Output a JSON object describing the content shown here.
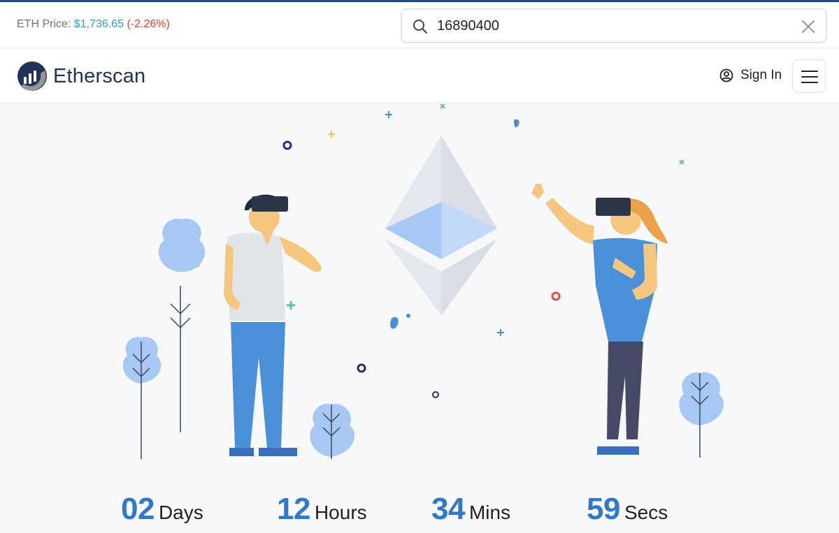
{
  "topbar": {
    "eth_price_label": "ETH Price:",
    "eth_price_value": "$1,736.65",
    "eth_price_change": "(-2.26%)"
  },
  "search": {
    "value": "16890400",
    "icon": "search-icon",
    "clear_icon": "close-icon"
  },
  "navbar": {
    "brand": "Etherscan",
    "sign_in_label": "Sign In",
    "menu_icon": "hamburger-menu-icon"
  },
  "countdown": {
    "days_value": "02",
    "days_label": "Days",
    "hours_value": "12",
    "hours_label": "Hours",
    "mins_value": "34",
    "mins_label": "Mins",
    "secs_value": "59",
    "secs_label": "Secs"
  },
  "colors": {
    "accent": "#3178c6",
    "brand_dark": "#21325b",
    "price_value": "#3498db",
    "price_negative": "#de4437",
    "hero_background": "#f7f8fa"
  }
}
